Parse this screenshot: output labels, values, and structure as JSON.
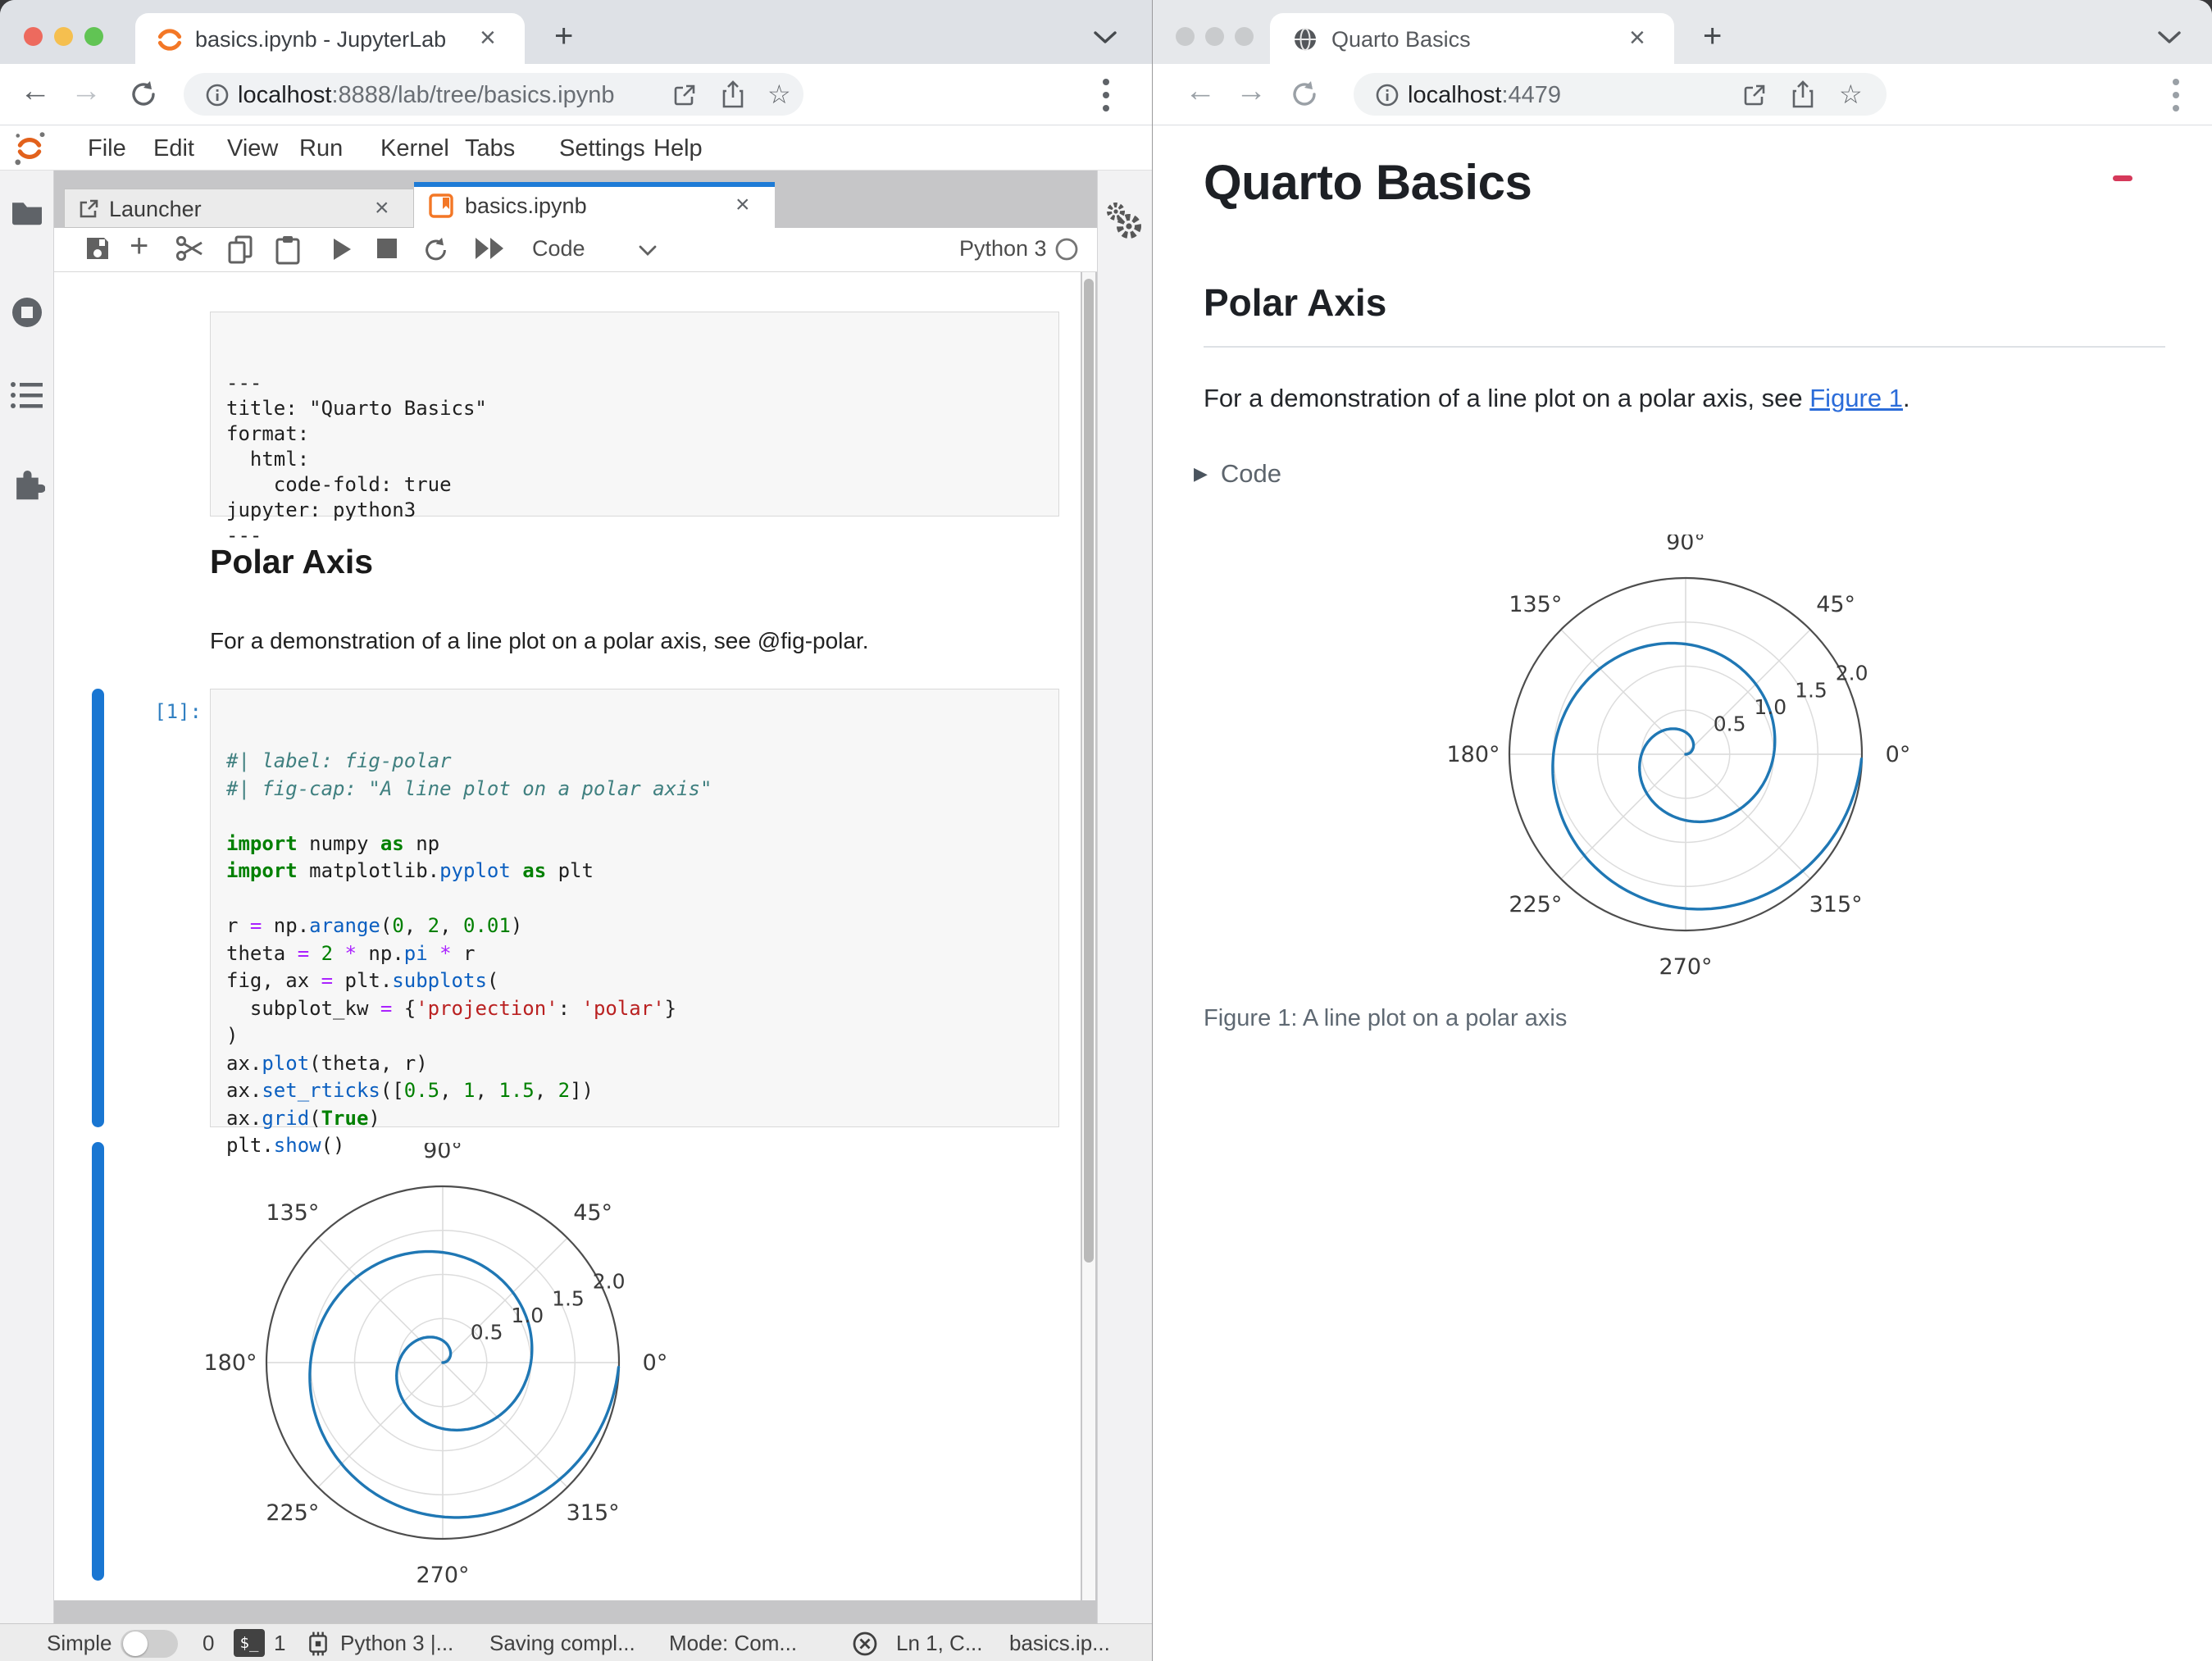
{
  "left_window": {
    "tab_title": "basics.ipynb - JupyterLab",
    "url": {
      "host": "localhost",
      "path": ":8888/lab/tree/basics.ipynb"
    },
    "menu": [
      "File",
      "Edit",
      "View",
      "Run",
      "Kernel",
      "Tabs",
      "Settings",
      "Help"
    ],
    "dock_tabs": {
      "launcher": "Launcher",
      "notebook": "basics.ipynb"
    },
    "toolbar": {
      "cell_type": "Code",
      "kernel_name": "Python 3"
    },
    "notebook": {
      "raw_lines": [
        "---",
        "title: \"Quarto Basics\"",
        "format:",
        "  html:",
        "    code-fold: true",
        "jupyter: python3",
        "---"
      ],
      "md_heading": "Polar Axis",
      "md_text": "For a demonstration of a line plot on a polar axis, see @fig-polar.",
      "prompt": "[1]:",
      "code_lines": [
        [
          [
            "cm",
            "#| label: fig-polar"
          ]
        ],
        [
          [
            "cm",
            "#| fig-cap: \"A line plot on a polar axis\""
          ]
        ],
        [],
        [
          [
            "kw",
            "import"
          ],
          [
            "pl",
            " numpy "
          ],
          [
            "kw",
            "as"
          ],
          [
            "pl",
            " np"
          ]
        ],
        [
          [
            "kw",
            "import"
          ],
          [
            "pl",
            " matplotlib."
          ],
          [
            "prop",
            "pyplot"
          ],
          [
            "pl",
            " "
          ],
          [
            "kw",
            "as"
          ],
          [
            "pl",
            " plt"
          ]
        ],
        [],
        [
          [
            "pl",
            "r "
          ],
          [
            "op",
            "="
          ],
          [
            "pl",
            " np."
          ],
          [
            "prop",
            "arange"
          ],
          [
            "pl",
            "("
          ],
          [
            "num",
            "0"
          ],
          [
            "pl",
            ", "
          ],
          [
            "num",
            "2"
          ],
          [
            "pl",
            ", "
          ],
          [
            "num",
            "0.01"
          ],
          [
            "pl",
            ")"
          ]
        ],
        [
          [
            "pl",
            "theta "
          ],
          [
            "op",
            "="
          ],
          [
            "pl",
            " "
          ],
          [
            "num",
            "2"
          ],
          [
            "pl",
            " "
          ],
          [
            "op",
            "*"
          ],
          [
            "pl",
            " np."
          ],
          [
            "prop",
            "pi"
          ],
          [
            "pl",
            " "
          ],
          [
            "op",
            "*"
          ],
          [
            "pl",
            " r"
          ]
        ],
        [
          [
            "pl",
            "fig, ax "
          ],
          [
            "op",
            "="
          ],
          [
            "pl",
            " plt."
          ],
          [
            "prop",
            "subplots"
          ],
          [
            "pl",
            "("
          ]
        ],
        [
          [
            "pl",
            "  subplot_kw "
          ],
          [
            "op",
            "="
          ],
          [
            "pl",
            " {"
          ],
          [
            "str",
            "'projection'"
          ],
          [
            "pl",
            ": "
          ],
          [
            "str",
            "'polar'"
          ],
          [
            "pl",
            "}"
          ]
        ],
        [
          [
            "pl",
            ")"
          ]
        ],
        [
          [
            "pl",
            "ax."
          ],
          [
            "prop",
            "plot"
          ],
          [
            "pl",
            "(theta, r)"
          ]
        ],
        [
          [
            "pl",
            "ax."
          ],
          [
            "prop",
            "set_rticks"
          ],
          [
            "pl",
            "(["
          ],
          [
            "num",
            "0.5"
          ],
          [
            "pl",
            ", "
          ],
          [
            "num",
            "1"
          ],
          [
            "pl",
            ", "
          ],
          [
            "num",
            "1.5"
          ],
          [
            "pl",
            ", "
          ],
          [
            "num",
            "2"
          ],
          [
            "pl",
            "])"
          ]
        ],
        [
          [
            "pl",
            "ax."
          ],
          [
            "prop",
            "grid"
          ],
          [
            "pl",
            "("
          ],
          [
            "kw",
            "True"
          ],
          [
            "pl",
            ")"
          ]
        ],
        [
          [
            "pl",
            "plt."
          ],
          [
            "prop",
            "show"
          ],
          [
            "pl",
            "()"
          ]
        ]
      ]
    },
    "statusbar": {
      "simple": "Simple",
      "terminals": "0",
      "terminal_badge": "$_",
      "kernels": "1",
      "kernel_status": "Python 3 |...",
      "saving": "Saving compl...",
      "mode": "Mode: Com...",
      "cursor": "Ln 1, C...",
      "file": "basics.ip..."
    }
  },
  "right_window": {
    "tab_title": "Quarto Basics",
    "url": {
      "host": "localhost",
      "path": ":4479"
    },
    "page": {
      "title": "Quarto Basics",
      "heading": "Polar Axis",
      "para_before": "For a demonstration of a line plot on a polar axis, see ",
      "link_text": "Figure 1",
      "para_after": ".",
      "code_summary": "Code",
      "caption": "Figure 1: A line plot on a polar axis"
    }
  },
  "chart_data": {
    "type": "line",
    "projection": "polar",
    "series": [
      {
        "name": "spiral",
        "definition": "r = np.arange(0, 2, 0.01); theta = 2 * pi * r",
        "r_start": 0,
        "r_end": 2,
        "r_step": 0.01
      }
    ],
    "r_ticks": [
      0.5,
      1.0,
      1.5,
      2.0
    ],
    "r_tick_labels": [
      "0.5",
      "1.0",
      "1.5",
      "2.0"
    ],
    "r_max": 2.0,
    "r_label_angle_deg": 22.5,
    "theta_ticks_deg": [
      0,
      45,
      90,
      135,
      180,
      225,
      270,
      315
    ],
    "theta_tick_labels": [
      "0°",
      "45°",
      "90°",
      "135°",
      "180°",
      "225°",
      "270°",
      "315°"
    ],
    "grid": true,
    "line_color": "#1f77b4",
    "caption": "Figure 1: A line plot on a polar axis",
    "instances": [
      "notebook-output",
      "quarto-figure"
    ]
  },
  "colors": {
    "accent_blue": "#1976d2",
    "mpl_line": "#1f77b4",
    "jupyter_orange": "#f37726",
    "link_blue": "#2b6cd9",
    "comment_teal": "#408080",
    "string_red": "#BA2121",
    "keyword_green": "#008000",
    "operator_purple": "#AA22FF",
    "property_blue": "#0b5fc0",
    "prompt_blue": "#307fc1"
  },
  "icons": {
    "traffic": [
      "close-icon",
      "minimize-icon",
      "zoom-icon"
    ],
    "browser": [
      "back-icon",
      "forward-icon",
      "reload-icon",
      "info-icon",
      "open-in-new-icon",
      "share-icon",
      "star-icon",
      "kebab-menu-icon",
      "chevron-down-icon",
      "globe-icon"
    ],
    "jupyterlab": [
      "jupyter-logo-icon",
      "notebook-file-icon",
      "launcher-icon",
      "folder-icon",
      "running-kernels-icon",
      "table-of-contents-icon",
      "extensions-icon",
      "gears-icon",
      "save-icon",
      "insert-cell-icon",
      "cut-icon",
      "copy-icon",
      "paste-icon",
      "run-icon",
      "stop-icon",
      "restart-icon",
      "run-all-icon",
      "kernel-circle-icon",
      "terminal-badge-icon",
      "chip-icon",
      "shield-x-icon"
    ]
  }
}
